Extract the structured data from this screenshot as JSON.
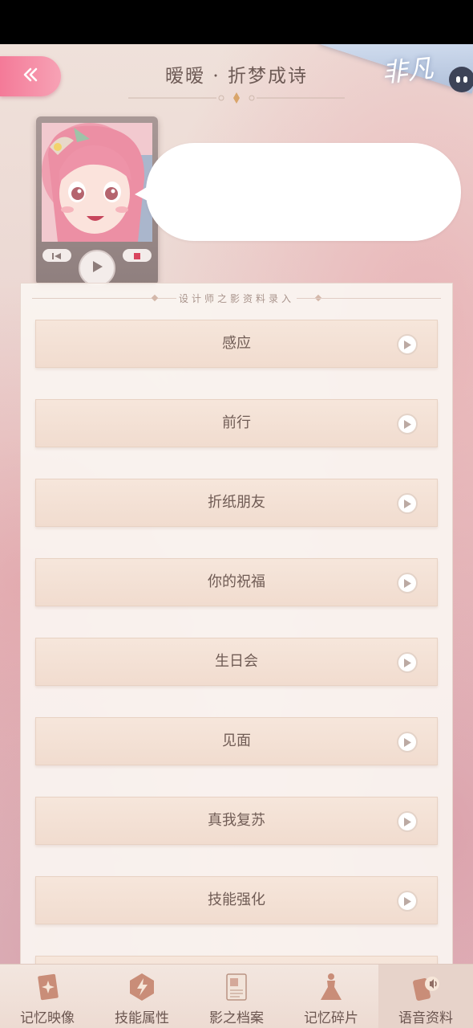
{
  "header": {
    "title": "暧暧 · 折梦成诗",
    "back_icon": "double-chevron-left-icon",
    "rarity_label": "非凡"
  },
  "panel": {
    "subtitle": "设计师之影资料录入"
  },
  "voice_lines": [
    {
      "label": "感应"
    },
    {
      "label": "前行"
    },
    {
      "label": "折纸朋友"
    },
    {
      "label": "你的祝福"
    },
    {
      "label": "生日会"
    },
    {
      "label": "见面"
    },
    {
      "label": "真我复苏"
    },
    {
      "label": "技能强化"
    }
  ],
  "tabs": [
    {
      "label": "记忆映像",
      "icon": "memory-card-icon",
      "active": false
    },
    {
      "label": "技能属性",
      "icon": "lightning-icon",
      "active": false
    },
    {
      "label": "影之档案",
      "icon": "document-icon",
      "active": false
    },
    {
      "label": "记忆碎片",
      "icon": "dress-icon",
      "active": false
    },
    {
      "label": "语音资料",
      "icon": "voice-phone-icon",
      "active": true
    }
  ],
  "colors": {
    "accent": "#f47a98",
    "text": "#705c55",
    "item_bg": "#f3e1d5"
  }
}
